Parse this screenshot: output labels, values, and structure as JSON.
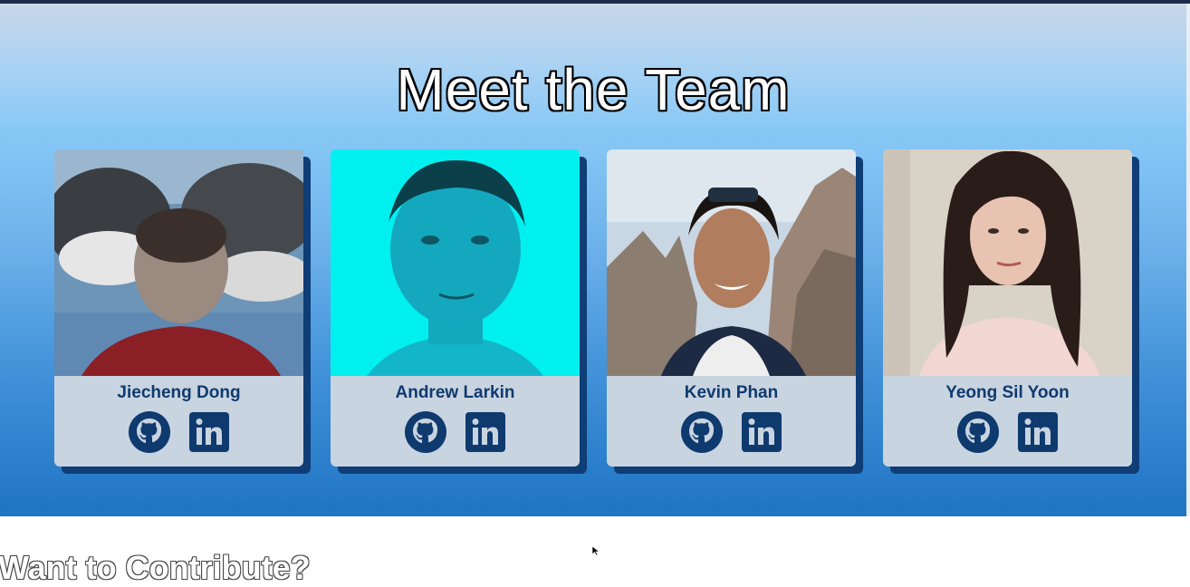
{
  "section": {
    "title": "Meet the Team"
  },
  "team": [
    {
      "name": "Jiecheng Dong",
      "photo": "photo of a person in front of orca whales",
      "github": "github-icon",
      "linkedin": "linkedin-icon"
    },
    {
      "name": "Andrew Larkin",
      "photo": "cyan-tinted portrait",
      "github": "github-icon",
      "linkedin": "linkedin-icon"
    },
    {
      "name": "Kevin Phan",
      "photo": "selfie in front of mountains",
      "github": "github-icon",
      "linkedin": "linkedin-icon"
    },
    {
      "name": "Yeong Sil Yoon",
      "photo": "portrait indoors",
      "github": "github-icon",
      "linkedin": "linkedin-icon"
    }
  ],
  "contribute": {
    "heading": "Want to Contribute?"
  },
  "colors": {
    "card": "#c9d4e1",
    "card_shadow": "#0f3d75",
    "icon": "#0f3a6e",
    "gradient_top": "#c8d8e8",
    "gradient_bottom": "#1f74c3"
  }
}
